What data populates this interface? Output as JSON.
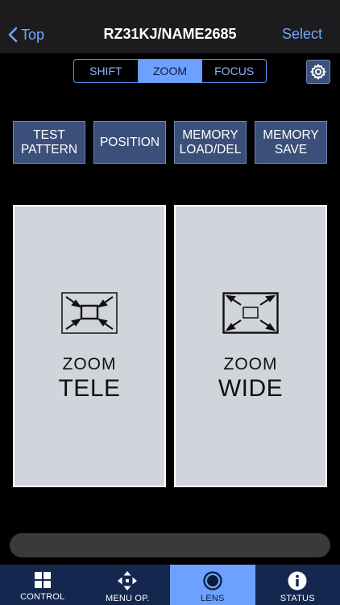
{
  "header": {
    "back_label": "Top",
    "title": "RZ31KJ/NAME2685",
    "select_label": "Select"
  },
  "segments": [
    {
      "label": "SHIFT",
      "active": false
    },
    {
      "label": "ZOOM",
      "active": true
    },
    {
      "label": "FOCUS",
      "active": false
    }
  ],
  "function_buttons": [
    {
      "label": "TEST\nPATTERN"
    },
    {
      "label": "POSITION"
    },
    {
      "label": "MEMORY\nLOAD/DEL"
    },
    {
      "label": "MEMORY\nSAVE"
    }
  ],
  "zoom_tele": {
    "line1": "ZOOM",
    "line2": "TELE",
    "icon": "zoom-in-arrows-icon"
  },
  "zoom_wide": {
    "line1": "ZOOM",
    "line2": "WIDE",
    "icon": "zoom-out-arrows-icon"
  },
  "tabs": [
    {
      "label": "CONTROL",
      "icon": "grid-icon",
      "active": false
    },
    {
      "label": "MENU OP.",
      "icon": "move-arrows-icon",
      "active": false
    },
    {
      "label": "LENS",
      "icon": "lens-icon",
      "active": true
    },
    {
      "label": "STATUS",
      "icon": "info-icon",
      "active": false
    }
  ],
  "colors": {
    "accent": "#6da0ff",
    "button_bg": "#3a4f79",
    "tabbar_bg": "#14284f",
    "pad_bg": "#d2d4dc"
  }
}
